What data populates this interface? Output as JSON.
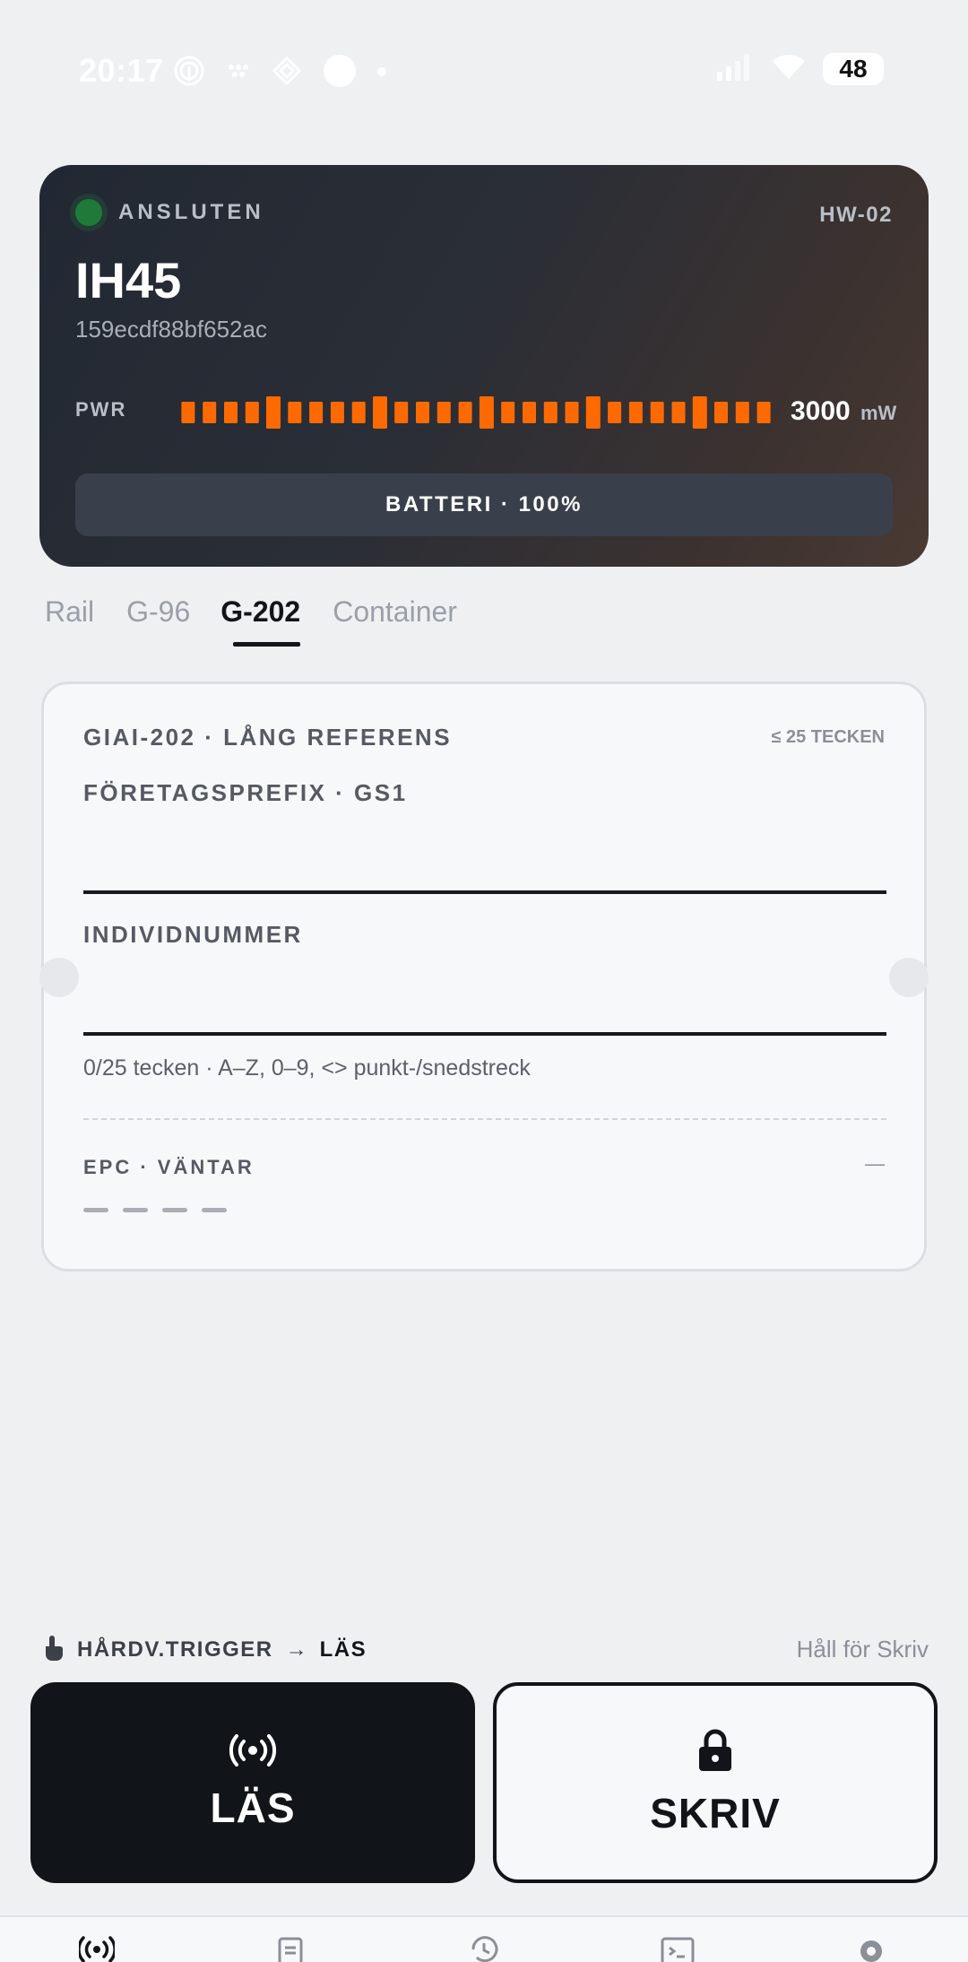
{
  "status_bar": {
    "time": "20:17",
    "battery": "48"
  },
  "device": {
    "connection_status": "ANSLUTEN",
    "hardware_id": "HW-02",
    "name": "IH45",
    "serial": "159ecdf88bf652ac",
    "power_label": "PWR",
    "power_value": "3000",
    "power_unit": "mW",
    "battery_button": "BATTERI · 100%",
    "status_color": "#1f7a3a",
    "power_bar_color": "#ff6a00"
  },
  "tabs": [
    {
      "label": "Rail",
      "active": false
    },
    {
      "label": "G-96",
      "active": false
    },
    {
      "label": "G-202",
      "active": true
    },
    {
      "label": "Container",
      "active": false
    }
  ],
  "form": {
    "title": "GIAI-202 · LÅNG REFERENS",
    "limit": "≤ 25 TECKEN",
    "prefix_label": "FÖRETAGSPREFIX · GS1",
    "prefix_value": "",
    "individual_label": "INDIVIDNUMMER",
    "individual_value": "",
    "hint": "0/25 tecken · A–Z, 0–9, <> punkt-/snedstreck",
    "epc_label": "EPC · VÄNTAR",
    "epc_value": "—"
  },
  "trigger": {
    "text": "HÅRDV.TRIGGER",
    "arrow": "→",
    "action": "LÄS",
    "hold_hint": "Håll för Skriv"
  },
  "actions": {
    "read_label": "LÄS",
    "write_label": "SKRIV"
  },
  "bottom_nav": {
    "items": [
      "radio-icon",
      "clipboard-icon",
      "history-icon",
      "terminal-icon",
      "gear-icon"
    ]
  }
}
